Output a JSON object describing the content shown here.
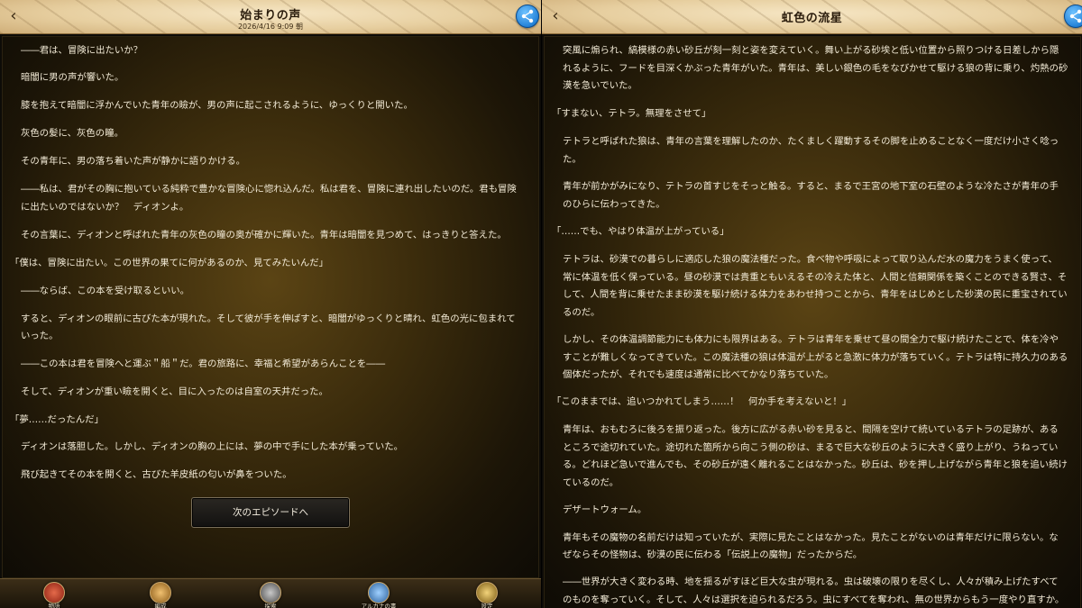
{
  "left": {
    "header": {
      "title": "始まりの声",
      "date": "2026/4/16 9:09 朝"
    },
    "paragraphs": [
      "――君は、冒険に出たいか？",
      "暗闇に男の声が響いた。",
      "膝を抱えて暗闇に浮かんでいた青年の瞼が、男の声に起こされるように、ゆっくりと開いた。",
      "灰色の髪に、灰色の瞳。",
      "その青年に、男の落ち着いた声が静かに語りかける。",
      "――私は、君がその胸に抱いている純粋で豊かな冒険心に惚れ込んだ。私は君を、冒険に連れ出したいのだ。君も冒険",
      "に出たいのではないか？　ディオンよ。",
      "その言葉に、ディオンと呼ばれた青年の灰色の瞳の奥が確かに輝いた。青年は暗闇を見つめて、はっきりと答えた。",
      "「僕は、冒険に出たい。この世界の果てに何があるのか、見てみたいんだ」",
      "――ならば、この本を受け取るといい。",
      "すると、ディオンの眼前に古びた本が現れた。そして彼が手を伸ばすと、暗闇がゆっくりと晴れ、虹色の光に包まれて",
      "いった。",
      "――この本は君を冒険へと運ぶ＂船＂だ。君の旅路に、幸福と希望があらんことを――",
      "そして、ディオンが重い瞼を開くと、目に入ったのは自室の天井だった。",
      "「夢……だったんだ」",
      "ディオンは落胆した。しかし、ディオンの胸の上には、夢の中で手にした本が乗っていた。",
      "飛び起きてその本を開くと、古びた羊皮紙の匂いが鼻をついた。"
    ],
    "next_button": "次のエピソードへ",
    "tabs": [
      {
        "label": "物語",
        "icon": "book-story-icon",
        "color": "#c03a28"
      },
      {
        "label": "編成",
        "icon": "party-formation-icon",
        "color": "#d89a3a"
      },
      {
        "label": "探索",
        "icon": "explore-icon",
        "color": "#8f8f8f"
      },
      {
        "label": "アルカナの書",
        "icon": "arcana-book-icon",
        "color": "#4f8fd0"
      },
      {
        "label": "設定",
        "icon": "settings-gear-icon",
        "color": "#c9a44a"
      }
    ]
  },
  "right": {
    "header": {
      "title": "虹色の流星"
    },
    "paragraphs": [
      "突風に煽られ、縞模様の赤い砂丘が刻一刻と姿を変えていく。舞い上がる砂埃と低い位置から照りつける日差しから隠",
      "れるように、フードを目深くかぶった青年がいた。青年は、美しい銀色の毛をなびかせて駆ける狼の背に乗り、灼熱の砂",
      "漠を急いでいた。",
      "「すまない、テトラ。無理をさせて」",
      "テトラと呼ばれた狼は、青年の言葉を理解したのか、たくましく躍動するその脚を止めることなく一度だけ小さく唸っ",
      "た。",
      "青年が前かがみになり、テトラの首すじをそっと触る。すると、まるで王宮の地下室の石壁のような冷たさが青年の手",
      "のひらに伝わってきた。",
      "「……でも、やはり体温が上がっている」",
      "テトラは、砂漠での暮らしに適応した狼の魔法種だった。食べ物や呼吸によって取り込んだ水の魔力をうまく使って、",
      "常に体温を低く保っている。昼の砂漠では貴重ともいえるその冷えた体と、人間と信頼関係を築くことのできる賢さ、そ",
      "して、人間を背に乗せたまま砂漠を駆け続ける体力をあわせ持つことから、青年をはじめとした砂漠の民に重宝されてい",
      "るのだ。",
      "しかし、その体温調節能力にも体力にも限界はある。テトラは青年を乗せて昼の間全力で駆け続けたことで、体を冷や",
      "すことが難しくなってきていた。この魔法種の狼は体温が上がると急激に体力が落ちていく。テトラは特に持久力のある",
      "個体だったが、それでも速度は通常に比べてかなり落ちていた。",
      "「このままでは、追いつかれてしまう……！　何か手を考えないと！」",
      "青年は、おもむろに後ろを振り返った。後方に広がる赤い砂を見ると、間隔を空けて続いているテトラの足跡が、ある",
      "ところで途切れていた。途切れた箇所から向こう側の砂は、まるで巨大な砂丘のように大きく盛り上がり、うねってい",
      "る。どれほど急いで進んでも、その砂丘が遠く離れることはなかった。砂丘は、砂を押し上げながら青年と狼を追い続け",
      "ているのだ。",
      "デザートウォーム。",
      "青年もその魔物の名前だけは知っていたが、実際に見たことはなかった。見たことがないのは青年だけに限らない。な",
      "ぜならその怪物は、砂漠の民に伝わる「伝説上の魔物」だったからだ。",
      "――世界が大きく変わる時、地を揺るがすほど巨大な虫が現れる。虫は破壊の限りを尽くし、人々が積み上げたすべて",
      "のものを奪っていく。そして、人々は選択を迫られるだろう。虫にすべてを奪われ、無の世界からもう一度やり直すか。"
    ]
  }
}
